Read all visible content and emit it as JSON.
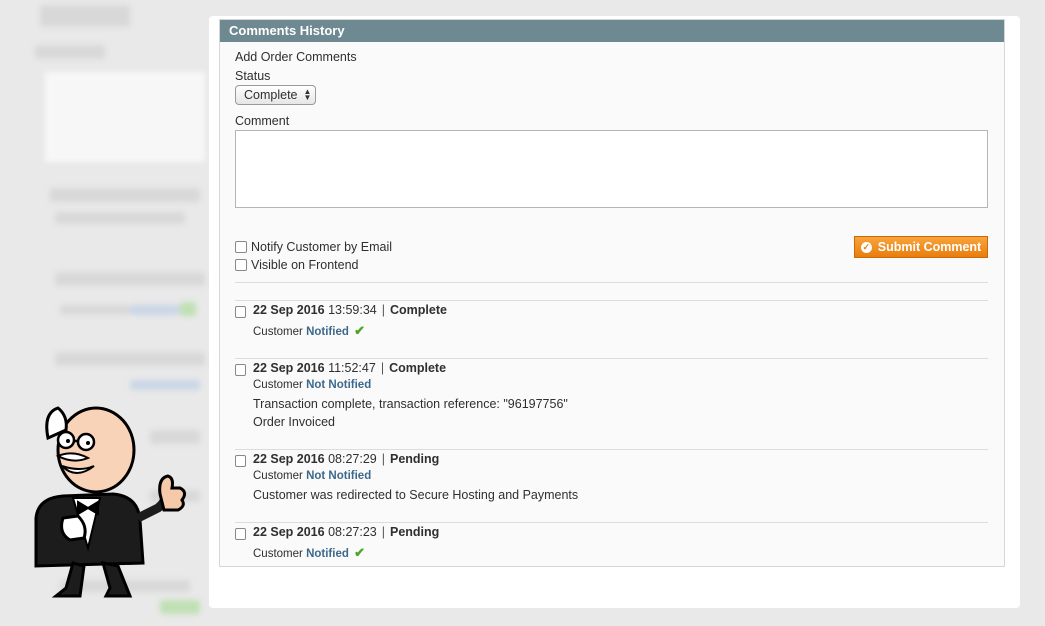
{
  "panel": {
    "title": "Comments History"
  },
  "form": {
    "heading": "Add Order Comments",
    "status_label": "Status",
    "status_value": "Complete",
    "comment_label": "Comment",
    "notify_label": "Notify Customer by Email",
    "visible_label": "Visible on Frontend",
    "submit_label": "Submit Comment"
  },
  "history": [
    {
      "date": "22 Sep 2016",
      "time": "13:59:34",
      "status": "Complete",
      "customer_prefix": "Customer",
      "notify": "Notified",
      "notified": true,
      "messages": []
    },
    {
      "date": "22 Sep 2016",
      "time": "11:52:47",
      "status": "Complete",
      "customer_prefix": "Customer",
      "notify": "Not Notified",
      "notified": false,
      "messages": [
        "Transaction complete, transaction reference: \"96197756\"",
        "Order Invoiced"
      ]
    },
    {
      "date": "22 Sep 2016",
      "time": "08:27:29",
      "status": "Pending",
      "customer_prefix": "Customer",
      "notify": "Not Notified",
      "notified": false,
      "messages": [
        "Customer was redirected to Secure Hosting and Payments"
      ]
    },
    {
      "date": "22 Sep 2016",
      "time": "08:27:23",
      "status": "Pending",
      "customer_prefix": "Customer",
      "notify": "Notified",
      "notified": true,
      "messages": []
    }
  ],
  "icons": {
    "notified": "green-check-icon",
    "select_arrows": "updown-arrows-icon",
    "submit": "check-circle-icon"
  },
  "colors": {
    "header": "#6f8992",
    "accent": "#ee8a1f",
    "notify_text": "#3d6a8c",
    "check_green": "#4fa52a"
  }
}
